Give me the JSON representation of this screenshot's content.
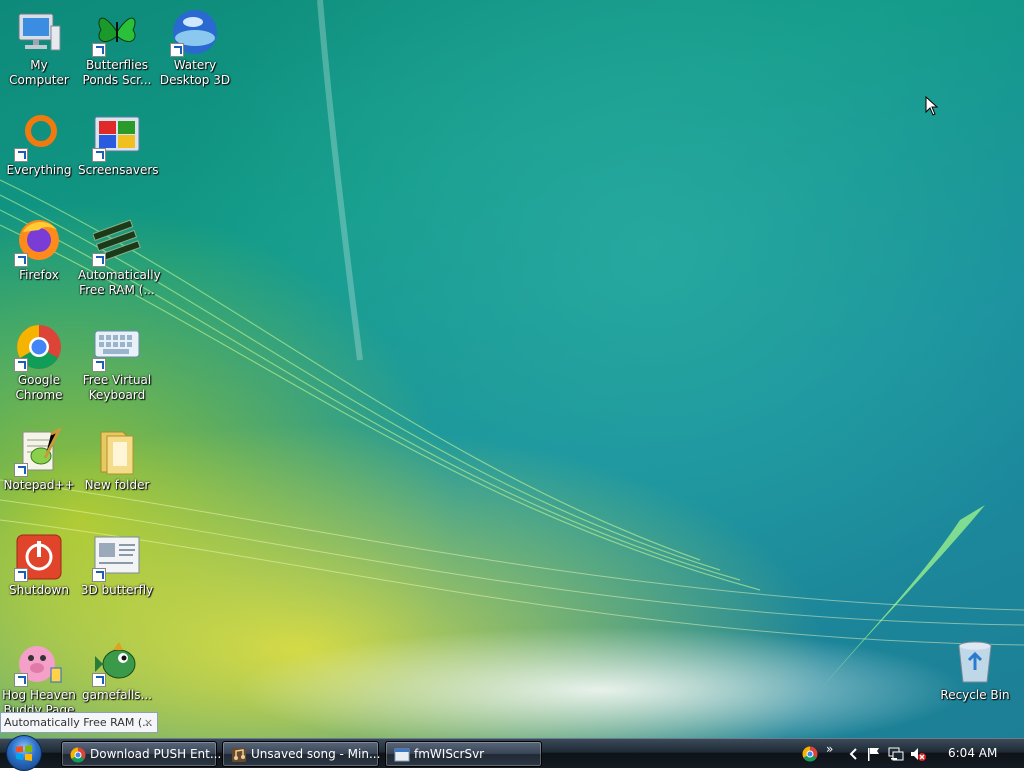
{
  "desktop_icons": [
    {
      "label": "My Computer",
      "icon": "computer-icon"
    },
    {
      "label": "Butterflies Ponds Scr...",
      "icon": "butterfly-icon"
    },
    {
      "label": "Watery Desktop 3D",
      "icon": "globe-icon"
    },
    {
      "label": "Everything",
      "icon": "search-ring-icon"
    },
    {
      "label": "Screensavers",
      "icon": "screensaver-icon"
    },
    {
      "label": "Firefox",
      "icon": "firefox-icon"
    },
    {
      "label": "Automatically Free RAM (...",
      "icon": "ram-icon"
    },
    {
      "label": "Google Chrome",
      "icon": "chrome-icon"
    },
    {
      "label": "Free Virtual Keyboard",
      "icon": "keyboard-icon"
    },
    {
      "label": "Notepad++",
      "icon": "notepad-icon"
    },
    {
      "label": "New folder",
      "icon": "folder-icon"
    },
    {
      "label": "Shutdown",
      "icon": "power-icon"
    },
    {
      "label": "3D butterfly",
      "icon": "window-icon"
    },
    {
      "label": "Hog Heaven Buddy Page",
      "icon": "pig-icon"
    },
    {
      "label": "gamefalls...",
      "icon": "fish-icon"
    },
    {
      "label": "Recycle Bin",
      "icon": "recycle-bin-icon"
    }
  ],
  "tooltip": {
    "text": "Automatically Free RAM (...",
    "close": "×"
  },
  "taskbar": {
    "tasks": [
      {
        "label": "Download PUSH Ent...",
        "icon": "chrome-icon"
      },
      {
        "label": "Unsaved song - Min...",
        "icon": "music-icon"
      },
      {
        "label": "fmWIScrSvr",
        "icon": "window-icon"
      }
    ],
    "tray_expand": "»",
    "clock": "6:04 AM"
  }
}
